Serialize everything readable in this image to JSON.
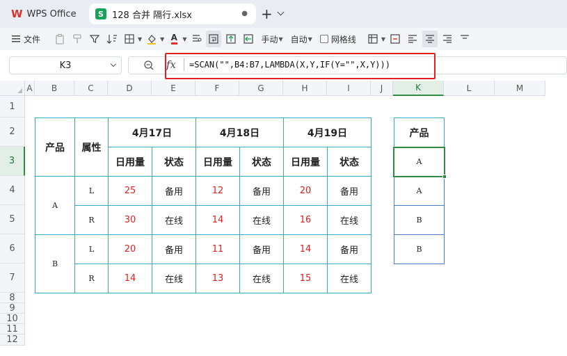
{
  "tabs": {
    "home_label": "WPS Office",
    "home_logo": "W",
    "doc_label": "128 合并 隔行.xlsx",
    "doc_logo": "S",
    "doc_modified_marker": "●",
    "new_tab_glyph": "+"
  },
  "toolbar": {
    "file_label": "文件",
    "manual_label": "手动",
    "auto_label": "自动",
    "gridlines_label": "网格线",
    "font_color_glyph": "A"
  },
  "formula_bar": {
    "cell_ref": "K3",
    "fx_label": "fx",
    "formula": "=SCAN(\"\",B4:B7,LAMBDA(X,Y,IF(Y=\"\",X,Y)))"
  },
  "columns": [
    "A",
    "B",
    "C",
    "D",
    "E",
    "F",
    "G",
    "H",
    "I",
    "J",
    "K",
    "L",
    "M"
  ],
  "rows": [
    "1",
    "2",
    "3",
    "4",
    "5",
    "6",
    "7",
    "8",
    "9",
    "10",
    "11",
    "12"
  ],
  "selected": {
    "column": "K",
    "row": "3"
  },
  "table": {
    "header_product": "产品",
    "header_attr": "属性",
    "dates": [
      "4月17日",
      "4月18日",
      "4月19日"
    ],
    "sub_usage": "日用量",
    "sub_status": "状态",
    "products": [
      "A",
      "B"
    ],
    "attrs": [
      "L",
      "R",
      "L",
      "R"
    ],
    "values": [
      [
        "25",
        "备用",
        "12",
        "备用",
        "20",
        "备用"
      ],
      [
        "30",
        "在线",
        "14",
        "在线",
        "16",
        "在线"
      ],
      [
        "20",
        "备用",
        "11",
        "备用",
        "14",
        "备用"
      ],
      [
        "14",
        "在线",
        "13",
        "在线",
        "15",
        "在线"
      ]
    ]
  },
  "result": {
    "header": "产品",
    "values": [
      "A",
      "A",
      "B",
      "B"
    ]
  },
  "colors": {
    "accent_green": "#2e8b3f",
    "highlight_red": "#e02020",
    "table_border": "#38a8c8",
    "usage_value": "#e02020"
  }
}
